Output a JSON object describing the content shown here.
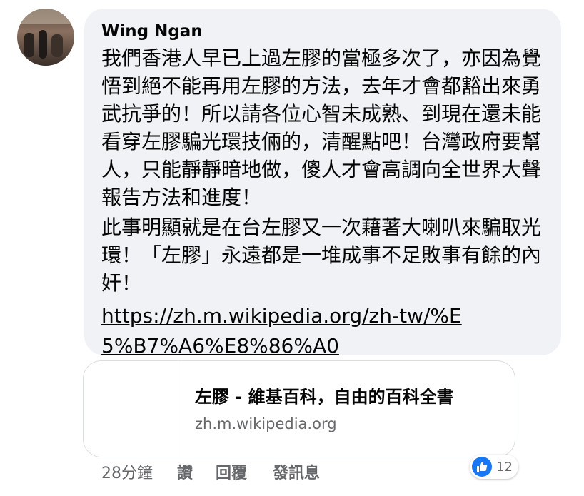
{
  "comment": {
    "author": "Wing Ngan",
    "paragraph1": "我們香港人早已上過左膠的當極多次了，亦因為覺悟到絕不能再用左膠的方法，去年才會都豁出來勇武抗爭的！所以請各位心智未成熟、到現在還未能看穿左膠騙光環技倆的，清醒點吧！台灣政府要幫人，只能靜靜暗地做，傻人才會高調向全世界大聲報告方法和進度！",
    "paragraph2": "此事明顯就是在台左膠又一次藉著大喇叭來騙取光環！「左膠」永遠都是一堆成事不足敗事有餘的內奸！",
    "link_text": "https://zh.m.wikipedia.org/zh-tw/%E5%B7%A6%E8%86%A0"
  },
  "link_preview": {
    "title": "左膠 - 維基百科，自由的百科全書",
    "domain": "zh.m.wikipedia.org"
  },
  "reactions": {
    "icon": "like-icon",
    "count": "12",
    "color": "#1877f2"
  },
  "actions": {
    "time": "28分鐘",
    "like": "讚",
    "reply": "回覆",
    "send_message": "發訊息"
  }
}
